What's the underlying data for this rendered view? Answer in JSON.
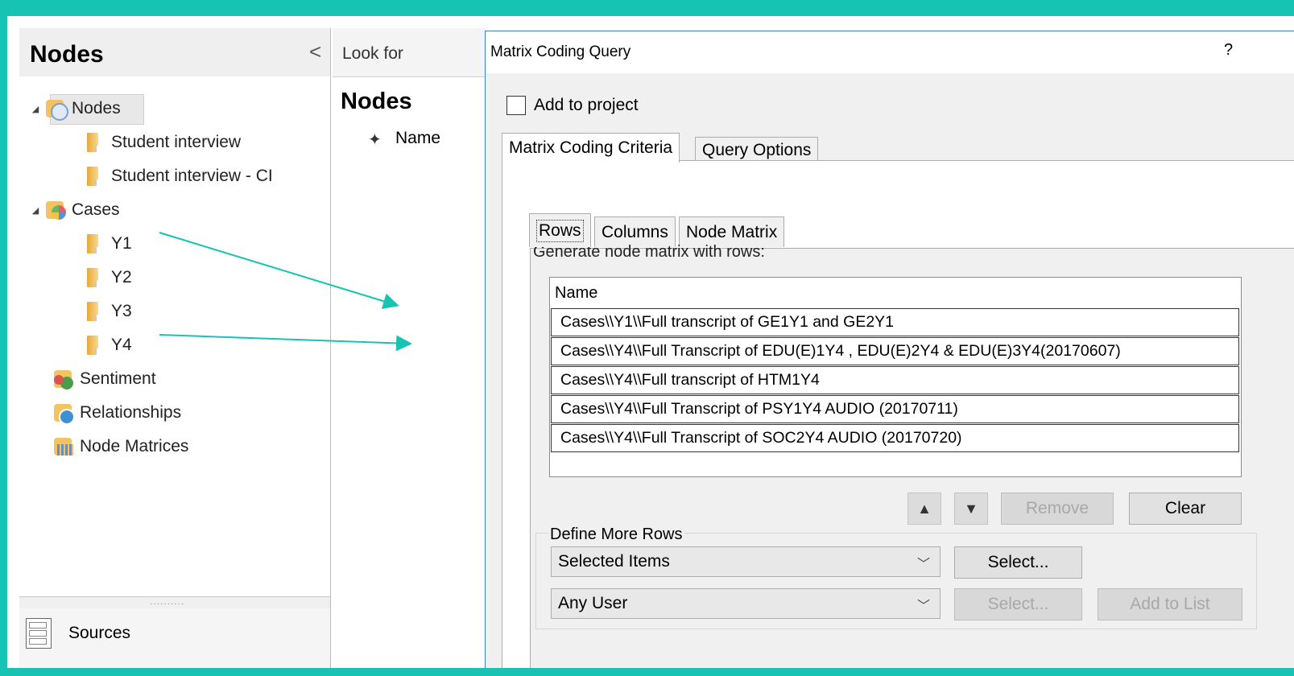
{
  "nav": {
    "title": "Nodes",
    "collapse_glyph": "<",
    "tree": [
      {
        "label": "Nodes",
        "expand": "◢",
        "icon": "nodes-icon"
      },
      {
        "label": "Student interview",
        "icon": "folder-icon"
      },
      {
        "label": "Student interview - CI",
        "icon": "folder-icon"
      },
      {
        "label": "Cases",
        "expand": "◢",
        "icon": "cases-icon"
      },
      {
        "label": "Y1",
        "icon": "folder-icon"
      },
      {
        "label": "Y2",
        "icon": "folder-icon"
      },
      {
        "label": "Y3",
        "icon": "folder-icon"
      },
      {
        "label": "Y4",
        "icon": "folder-icon"
      },
      {
        "label": "Sentiment",
        "icon": "sentiment-icon"
      },
      {
        "label": "Relationships",
        "icon": "relationships-icon"
      },
      {
        "label": "Node Matrices",
        "icon": "node-matrices-icon"
      }
    ],
    "bottom_section": "Sources"
  },
  "middle": {
    "look_for": "Look for",
    "title": "Nodes",
    "column_name": "Name"
  },
  "dialog": {
    "title": "Matrix Coding Query",
    "help": "?",
    "add_to_project": "Add to project",
    "tabs": [
      "Matrix Coding Criteria",
      "Query Options"
    ],
    "subtabs": [
      "Rows",
      "Columns",
      "Node Matrix"
    ],
    "generate_label": "Generate node matrix with rows:",
    "list_header": "Name",
    "rows": [
      "Cases\\\\Y1\\\\Full transcript of GE1Y1 and GE2Y1",
      "Cases\\\\Y4\\\\Full Transcript of EDU(E)1Y4 , EDU(E)2Y4 & EDU(E)3Y4(20170607)",
      "Cases\\\\Y4\\\\Full transcript of HTM1Y4",
      "Cases\\\\Y4\\\\Full Transcript of PSY1Y4 AUDIO (20170711)",
      "Cases\\\\Y4\\\\Full Transcript of SOC2Y4 AUDIO (20170720)"
    ],
    "remove": "Remove",
    "clear": "Clear",
    "define_more_rows": "Define More Rows",
    "combo_items": "Selected Items",
    "combo_user": "Any User",
    "select": "Select...",
    "select_disabled": "Select...",
    "add_to_list": "Add to List"
  },
  "colors": {
    "border_accent": "#17c3b2",
    "annotation_arrow": "#17c3b2",
    "dialog_border": "#3b7fcf"
  }
}
